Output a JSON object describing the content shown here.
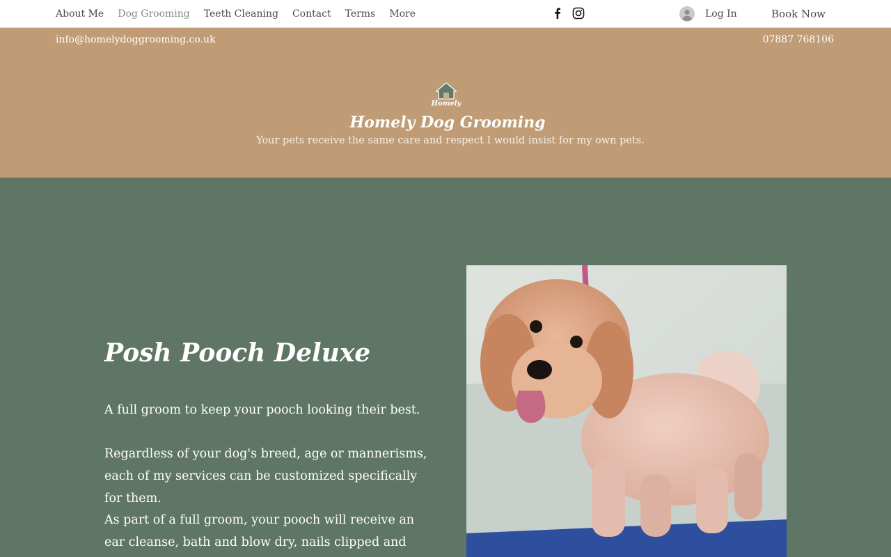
{
  "nav": {
    "links": [
      {
        "label": "About Me",
        "active": false
      },
      {
        "label": "Dog Grooming",
        "active": true
      },
      {
        "label": "Teeth Cleaning",
        "active": false
      },
      {
        "label": "Contact",
        "active": false
      },
      {
        "label": "Terms",
        "active": false
      },
      {
        "label": "More",
        "active": false
      }
    ],
    "social_icons": [
      "facebook-icon",
      "instagram-icon"
    ],
    "login_label": "Log In",
    "book_now_label": "Book Now"
  },
  "header": {
    "email": "info@homelydoggrooming.co.uk",
    "phone": "07887 768106",
    "logo_text": "Homely",
    "title": "Homely Dog Grooming",
    "tagline": "Your pets receive the same care and respect I would insist for my own pets."
  },
  "service": {
    "title": "Posh Pooch Deluxe",
    "paragraphs": [
      "A full groom to keep your pooch looking their best.",
      "Regardless of your dog's breed, age or mannerisms, each of my services can be customized specifically for them.",
      "As part of a full groom, your pooch will receive an ear cleanse, bath and blow dry, nails clipped and spritz of dog"
    ]
  },
  "colors": {
    "header_bg": "#bf9c76",
    "main_bg": "#5f7565",
    "nav_active": "#7d8f7f"
  }
}
